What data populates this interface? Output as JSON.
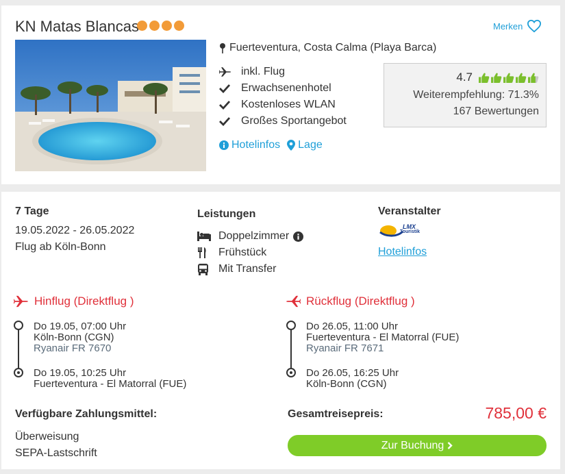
{
  "hotel": {
    "name": "KN Matas Blancas",
    "stars": 4,
    "merken_label": "Merken",
    "location": "Fuerteventura, Costa Calma (Playa Barca)",
    "features": [
      "inkl. Flug",
      "Erwachsenenhotel",
      "Kostenloses WLAN",
      "Großes Sportangebot"
    ],
    "links": {
      "hotelinfos": "Hotelinfos",
      "lage": "Lage"
    },
    "rating": {
      "score": "4.7",
      "thumbs": 4.7,
      "recommendation": "Weiterempfehlung: 71.3%",
      "reviews": "167 Bewertungen"
    }
  },
  "offer": {
    "duration": "7 Tage",
    "dates": "19.05.2022 - 26.05.2022",
    "departure": "Flug ab Köln-Bonn",
    "leistungen_title": "Leistungen",
    "leistungen": [
      "Doppelzimmer",
      "Frühstück",
      "Mit Transfer"
    ],
    "veranstalter_title": "Veranstalter",
    "veranstalter_logo": {
      "line1": "LMX",
      "line2": "Touristik"
    },
    "veranstalter_link": "Hotelinfos",
    "outbound": {
      "title": "Hinflug (Direktflug )",
      "dep_time": "Do 19.05, 07:00 Uhr",
      "dep_airport": "Köln-Bonn (CGN)",
      "airline": "Ryanair FR 7670",
      "arr_time": "Do 19.05, 10:25 Uhr",
      "arr_airport": "Fuerteventura - El Matorral (FUE)"
    },
    "return": {
      "title": "Rückflug (Direktflug )",
      "dep_time": "Do 26.05, 11:00 Uhr",
      "dep_airport": "Fuerteventura - El Matorral (FUE)",
      "airline": "Ryanair FR 7671",
      "arr_time": "Do 26.05, 16:25 Uhr",
      "arr_airport": "Köln-Bonn (CGN)"
    },
    "payment_title": "Verfügbare Zahlungsmittel:",
    "payment_methods": [
      "Überweisung",
      "SEPA-Lastschrift"
    ],
    "total_label": "Gesamtreisepreis:",
    "total_price": "785,00 €",
    "book_label": "Zur Buchung"
  },
  "colors": {
    "accent": "#1f9fd8",
    "price": "#e0303a",
    "button": "#7fcc28",
    "star": "#f29b38",
    "thumb": "#7bbf2c"
  }
}
